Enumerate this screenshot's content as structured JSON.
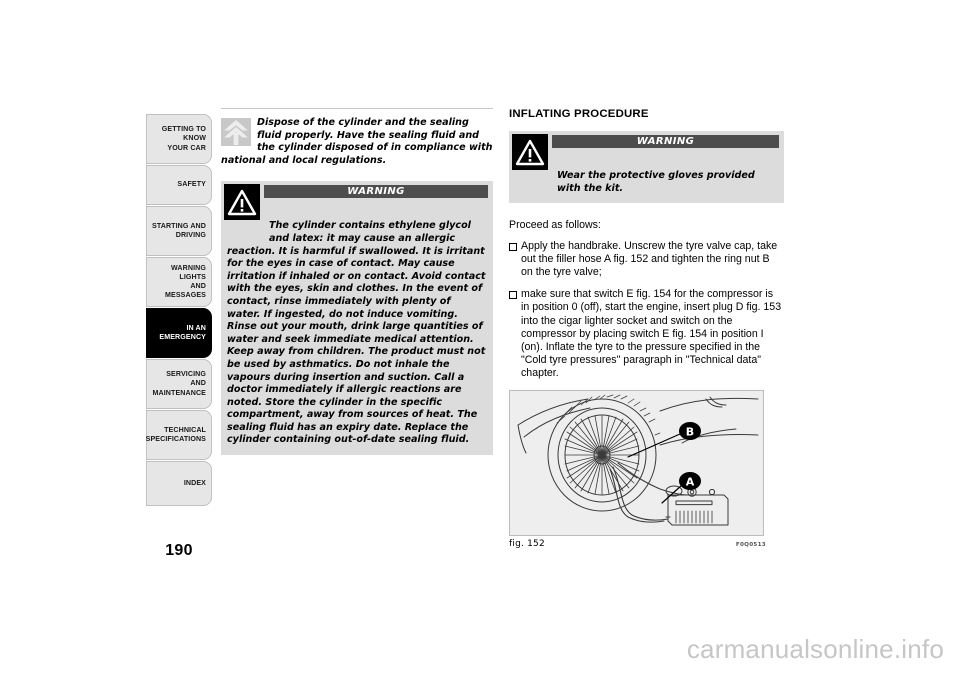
{
  "sidebar": {
    "items": [
      {
        "label": "GETTING TO KNOW\nYOUR CAR",
        "active": false
      },
      {
        "label": "SAFETY",
        "active": false
      },
      {
        "label": "STARTING AND\nDRIVING",
        "active": false
      },
      {
        "label": "WARNING LIGHTS\nAND MESSAGES",
        "active": false
      },
      {
        "label": "IN AN\nEMERGENCY",
        "active": true
      },
      {
        "label": "SERVICING AND\nMAINTENANCE",
        "active": false
      },
      {
        "label": "TECHNICAL\nSPECIFICATIONS",
        "active": false
      },
      {
        "label": "INDEX",
        "active": false
      }
    ],
    "page_number": "190"
  },
  "left_column": {
    "eco_note": {
      "icon": "up-chevrons-icon",
      "indented_text": "Dispose of the cylinder and the sealing fluid properly. Have the sealing fluid and the cylinder disposed of in compliance",
      "full_width_text": "with national and local regulations."
    },
    "warning": {
      "icon": "warning-triangle-icon",
      "title": "WARNING",
      "indented_text": "The cylinder contains ethylene glycol and latex: it may cause an allergic",
      "body_text": "reaction. It is harmful if swallowed. It is irritant for the eyes in case of contact. May cause irritation if inhaled or on contact. Avoid contact with the eyes, skin and clothes. In the event of contact, rinse immediately with plenty of water. If ingested, do not induce vomiting. Rinse out your mouth, drink large quantities of water and seek immediate medical attention. Keep away from children. The product must not be used by asthmatics. Do not inhale the vapours during insertion and suction. Call a doctor immediately if allergic reactions are noted. Store the cylinder in the specific compartment, away from sources of heat. The sealing fluid has an expiry date. Replace the cylinder containing out-of-date sealing fluid."
    }
  },
  "right_column": {
    "section_title": "INFLATING PROCEDURE",
    "warning": {
      "icon": "warning-triangle-icon",
      "title": "WARNING",
      "body_text": "Wear the protective gloves provided with the kit."
    },
    "proceed_label": "Proceed as follows:",
    "bullets": [
      "Apply the handbrake. Unscrew the tyre valve cap, take out the filler hose A fig. 152 and tighten the ring nut B on the tyre valve;",
      "make sure that switch E fig. 154 for the compressor is in position 0 (off), start the engine, insert plug D fig. 153 into the cigar lighter socket and switch on the compressor by placing switch E fig. 154 in position I (on). Inflate the tyre to the pressure specified in the \"Cold tyre pressures\" paragraph in \"Technical data\" chapter."
    ],
    "figure": {
      "caption": "fig. 152",
      "code": "F0Q0513",
      "callouts": [
        "B",
        "A"
      ],
      "alt": "wheel-with-compressor-illustration"
    }
  },
  "watermark": "carmanualsonline.info",
  "colors": {
    "active_tab_bg": "#000000",
    "tab_bg": "#e6e6e6",
    "warning_box_bg": "#dcdcdc",
    "warning_title_bg": "#4d4d4d",
    "figure_bg": "#eeeeee",
    "watermark": "#c6c6c6"
  }
}
